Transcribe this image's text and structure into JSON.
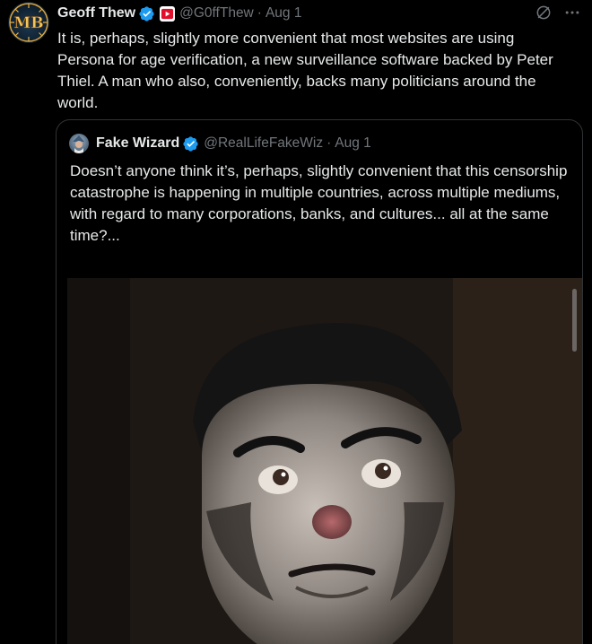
{
  "tweet": {
    "author_name": "Geoff Thew",
    "handle": "@G0ffThew",
    "separator": "·",
    "date": "Aug 1",
    "text": "It is, perhaps, slightly more convenient that most websites are using Persona for age verification, a new surveillance software backed by Peter Thiel. A man who also, conveniently, backs many politicians around the world.",
    "avatar_monogram": "MB",
    "icons": [
      "verified-badge-icon",
      "affiliate-badge-icon",
      "grok-icon",
      "more-options-icon"
    ]
  },
  "quoted": {
    "author_name": "Fake Wizard",
    "handle": "@RealLifeFakeWiz",
    "separator": "·",
    "date": "Aug 1",
    "text_lines": [
      "Doesn’t anyone think it’s, perhaps, slightly convenient that this censorship",
      "catastrophe is happening in multiple countries, across multiple mediums, with regard to many corporations, banks, and cultures... all at the same time?..."
    ],
    "media_description": "Animated still of a caricatured man with slicked dark hair looking upward"
  },
  "colors": {
    "background": "#000000",
    "text": "#e7e9ea",
    "muted": "#71767b",
    "verified_blue": "#1d9bf0",
    "border": "#2f3336"
  }
}
